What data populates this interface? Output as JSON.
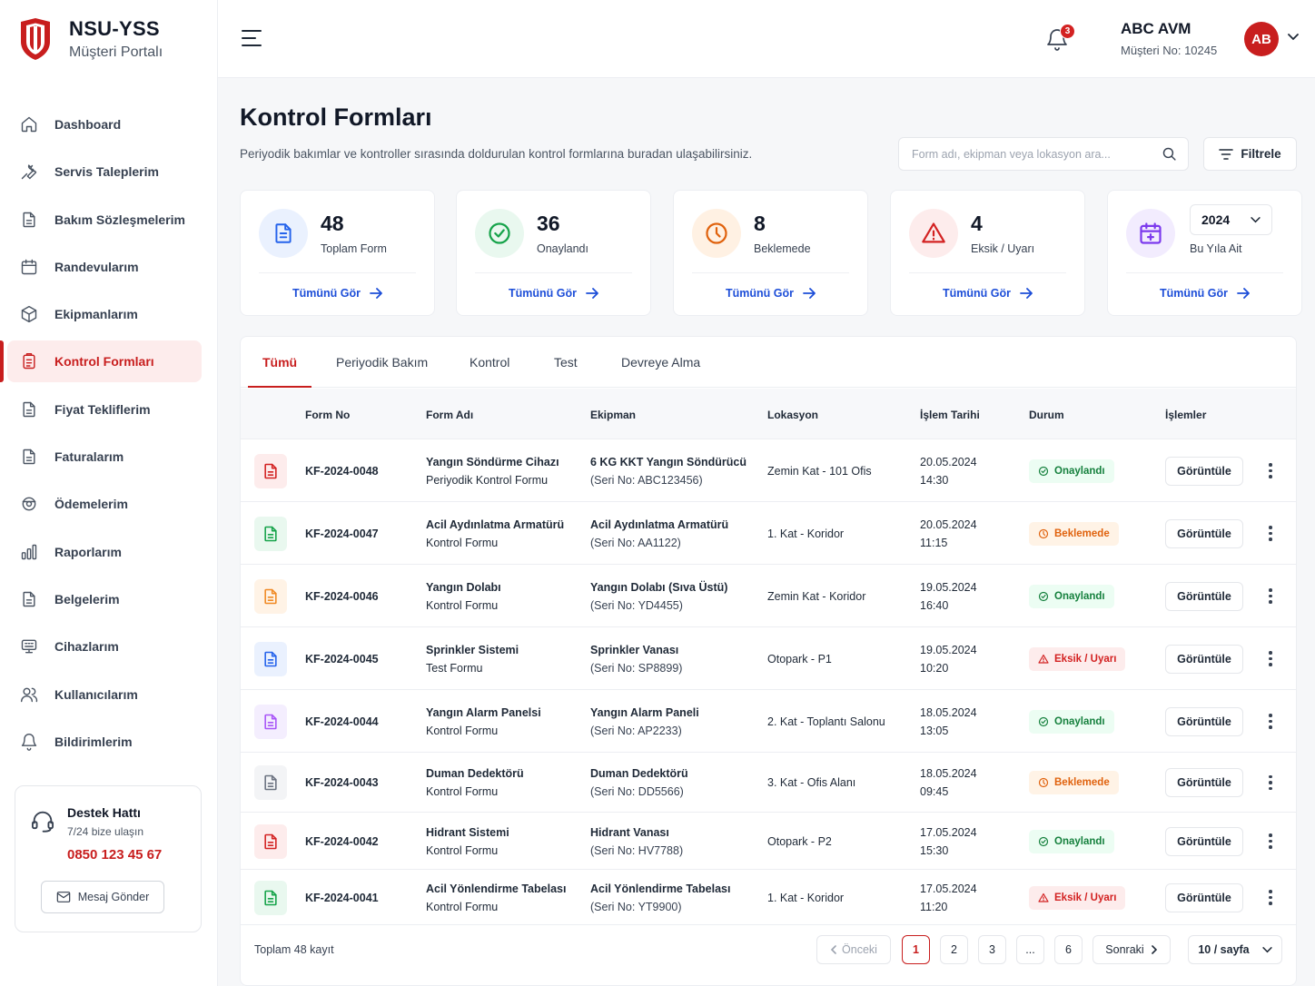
{
  "brand": {
    "name": "NSU-YSS",
    "subtitle": "Müşteri Portalı"
  },
  "sidebar": {
    "items": [
      {
        "label": "Dashboard",
        "icon": "home-icon"
      },
      {
        "label": "Servis Taleplerim",
        "icon": "wrench-icon"
      },
      {
        "label": "Bakım Sözleşmelerim",
        "icon": "document-icon"
      },
      {
        "label": "Randevularım",
        "icon": "calendar-icon"
      },
      {
        "label": "Ekipmanlarım",
        "icon": "box-icon"
      },
      {
        "label": "Kontrol Formları",
        "icon": "clipboard-icon",
        "active": true
      },
      {
        "label": "Fiyat Tekliflerim",
        "icon": "document-icon"
      },
      {
        "label": "Faturalarım",
        "icon": "document-icon"
      },
      {
        "label": "Ödemelerim",
        "icon": "wallet-icon"
      },
      {
        "label": "Raporlarım",
        "icon": "bar-chart-icon"
      },
      {
        "label": "Belgelerim",
        "icon": "document-icon"
      },
      {
        "label": "Cihazlarım",
        "icon": "monitor-icon"
      },
      {
        "label": "Kullanıcılarım",
        "icon": "users-icon"
      },
      {
        "label": "Bildirimlerim",
        "icon": "bell-icon"
      }
    ]
  },
  "support": {
    "title": "Destek Hattı",
    "subtitle": "7/24 bize ulaşın",
    "phone": "0850 123 45 67",
    "button": "Mesaj Gönder"
  },
  "header": {
    "notification_count": "3",
    "company": "ABC AVM",
    "customer_no": "Müşteri No: 10245",
    "avatar_initials": "AB"
  },
  "page": {
    "title": "Kontrol Formları",
    "description": "Periyodik bakımlar ve kontroller sırasında doldurulan kontrol formlarına buradan ulaşabilirsiniz.",
    "search_placeholder": "Form adı, ekipman veya lokasyon ara...",
    "filter_label": "Filtrele"
  },
  "stats": [
    {
      "value": "48",
      "label": "Toplam Form",
      "link": "Tümünü Gör",
      "color": "#2563eb",
      "bg": "#eaf1fe"
    },
    {
      "value": "36",
      "label": "Onaylandı",
      "link": "Tümünü Gör",
      "color": "#16a34a",
      "bg": "#e9f8ef"
    },
    {
      "value": "8",
      "label": "Beklemede",
      "link": "Tümünü Gör",
      "color": "#e0620d",
      "bg": "#fff1e3"
    },
    {
      "value": "4",
      "label": "Eksik / Uyarı",
      "link": "Tümünü Gör",
      "color": "#d32222",
      "bg": "#fdecec"
    },
    {
      "value": "2024",
      "label": "Bu Yıla Ait",
      "link": "Tümünü Gör",
      "color": "#7c3aed",
      "bg": "#f2ecfe"
    }
  ],
  "tabs": [
    "Tümü",
    "Periyodik Bakım",
    "Kontrol",
    "Test",
    "Devreye Alma"
  ],
  "table": {
    "columns": [
      "Form No",
      "Form Adı",
      "Ekipman",
      "Lokasyon",
      "İşlem Tarihi",
      "Durum",
      "İşlemler"
    ],
    "rows": [
      {
        "no": "KF-2024-0048",
        "name1": "Yangın Söndürme Cihazı",
        "name2": "Periyodik Kontrol Formu",
        "eq1": "6 KG KKT Yangın Söndürücü",
        "eq2": "(Seri No: ABC123456)",
        "location": "Zemin Kat - 101 Ofis",
        "date": "20.05.2024",
        "time": "14:30",
        "status": "Onaylandı",
        "status_type": "ok",
        "icon_color": "#d32222",
        "icon_bg": "#fdecec"
      },
      {
        "no": "KF-2024-0047",
        "name1": "Acil Aydınlatma Armatürü",
        "name2": "Kontrol Formu",
        "eq1": "Acil Aydınlatma Armatürü",
        "eq2": "(Seri No: AA1122)",
        "location": "1. Kat - Koridor",
        "date": "20.05.2024",
        "time": "11:15",
        "status": "Beklemede",
        "status_type": "wait",
        "icon_color": "#16a34a",
        "icon_bg": "#e9f8ef"
      },
      {
        "no": "KF-2024-0046",
        "name1": "Yangın Dolabı",
        "name2": "Kontrol Formu",
        "eq1": "Yangın Dolabı (Sıva Üstü)",
        "eq2": "(Seri No: YD4455)",
        "location": "Zemin Kat - Koridor",
        "date": "19.05.2024",
        "time": "16:40",
        "status": "Onaylandı",
        "status_type": "ok",
        "icon_color": "#f08a24",
        "icon_bg": "#fff3e6"
      },
      {
        "no": "KF-2024-0045",
        "name1": "Sprinkler Sistemi",
        "name2": "Test Formu",
        "eq1": "Sprinkler Vanası",
        "eq2": "(Seri No: SP8899)",
        "location": "Otopark - P1",
        "date": "19.05.2024",
        "time": "10:20",
        "status": "Eksik / Uyarı",
        "status_type": "warn",
        "icon_color": "#2563eb",
        "icon_bg": "#eaf1fe"
      },
      {
        "no": "KF-2024-0044",
        "name1": "Yangın Alarm Panelsi",
        "name2": "Kontrol Formu",
        "eq1": "Yangın Alarm Paneli",
        "eq2": "(Seri No: AP2233)",
        "location": "2. Kat - Toplantı Salonu",
        "date": "18.05.2024",
        "time": "13:05",
        "status": "Onaylandı",
        "status_type": "ok",
        "icon_color": "#a855f7",
        "icon_bg": "#f4eefe"
      },
      {
        "no": "KF-2024-0043",
        "name1": "Duman Dedektörü",
        "name2": "Kontrol Formu",
        "eq1": "Duman Dedektörü",
        "eq2": "(Seri No: DD5566)",
        "location": "3. Kat - Ofis Alanı",
        "date": "18.05.2024",
        "time": "09:45",
        "status": "Beklemede",
        "status_type": "wait",
        "icon_color": "#6b7280",
        "icon_bg": "#f3f4f6"
      },
      {
        "no": "KF-2024-0042",
        "name1": "Hidrant Sistemi",
        "name2": "Kontrol Formu",
        "eq1": "Hidrant Vanası",
        "eq2": "(Seri No: HV7788)",
        "location": "Otopark - P2",
        "date": "17.05.2024",
        "time": "15:30",
        "status": "Onaylandı",
        "status_type": "ok",
        "icon_color": "#d32222",
        "icon_bg": "#fdecec"
      },
      {
        "no": "KF-2024-0041",
        "name1": "Acil Yönlendirme Tabelası",
        "name2": "Kontrol Formu",
        "eq1": "Acil Yönlendirme Tabelası",
        "eq2": "(Seri No: YT9900)",
        "location": "1. Kat - Koridor",
        "date": "17.05.2024",
        "time": "11:20",
        "status": "Eksik / Uyarı",
        "status_type": "warn",
        "icon_color": "#16a34a",
        "icon_bg": "#e9f8ef"
      }
    ],
    "view_label": "Görüntüle"
  },
  "pagination": {
    "total": "Toplam 48 kayıt",
    "prev": "Önceki",
    "pages": [
      "1",
      "2",
      "3",
      "...",
      "6"
    ],
    "current": "1",
    "next": "Sonraki",
    "per_page": "10 / sayfa"
  }
}
